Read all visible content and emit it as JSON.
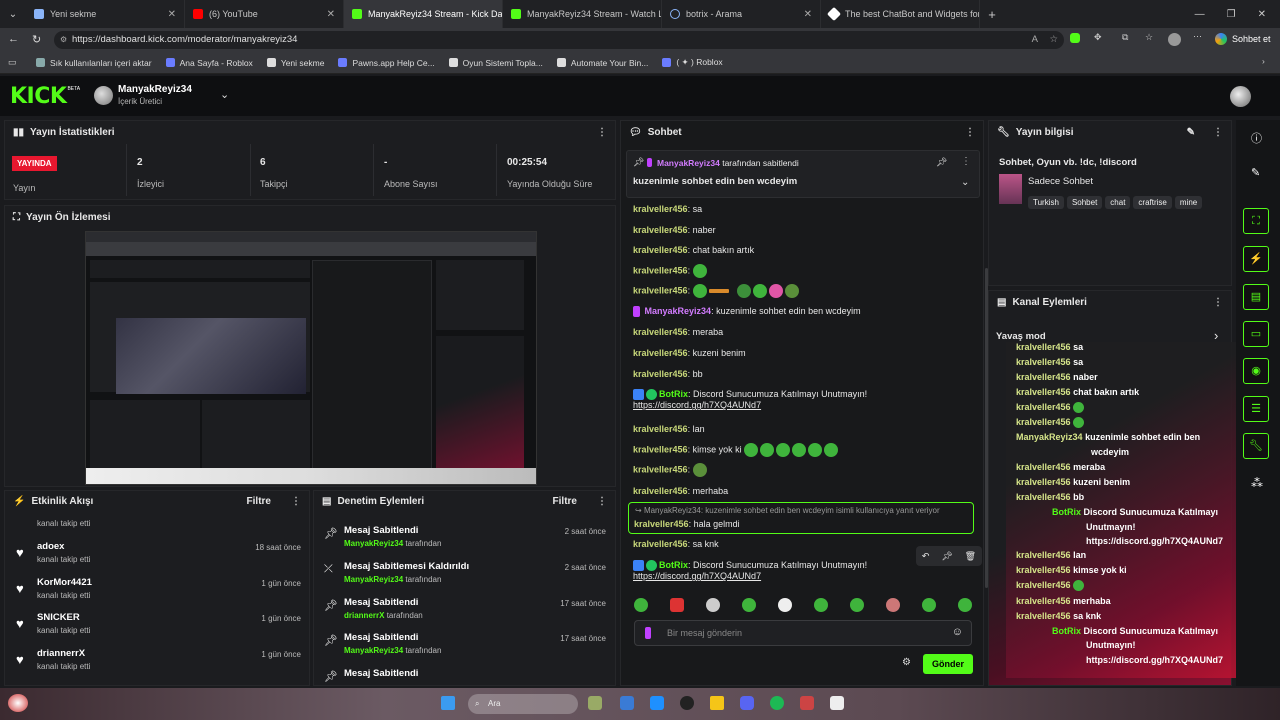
{
  "tabs": [
    {
      "title": "Yeni sekme",
      "icon": "new-tab-icon",
      "color": "#8ab4f8"
    },
    {
      "title": "(6) YouTube",
      "icon": "youtube-icon",
      "color": "#ff0000"
    },
    {
      "title": "ManyakReyiz34 Stream - Kick Dash",
      "icon": "kick-icon",
      "color": "#53fc18",
      "active": true
    },
    {
      "title": "ManyakReyiz34 Stream - Watch Li",
      "icon": "kick-icon",
      "color": "#53fc18"
    },
    {
      "title": "botrix - Arama",
      "icon": "search-icon",
      "color": "#8ab4f8"
    },
    {
      "title": "The best ChatBot and Widgets for",
      "icon": "botrix-icon",
      "color": "#ffffff"
    }
  ],
  "address": {
    "url": "https://dashboard.kick.com/moderator/manyakreyiz34",
    "chat_button": "Sohbet et"
  },
  "bookmarks": [
    "Sık kullanılanları içeri aktar",
    "Ana Sayfa - Roblox",
    "Yeni sekme",
    "Pawns.app Help Ce...",
    "Oyun Sistemi Topla...",
    "Automate Your Bin...",
    "( ✦ ) Roblox"
  ],
  "header": {
    "logo": "KICK",
    "beta": "BETA",
    "channel": "ManyakReyiz34",
    "role": "İçerik Üretici"
  },
  "stats": {
    "title": "Yayın İstatistikleri",
    "live_badge": "YAYINDA",
    "live_label": "Yayın",
    "viewers": "2",
    "viewers_label": "İzleyici",
    "followers": "6",
    "followers_label": "Takipçi",
    "subs": "-",
    "subs_label": "Abone Sayısı",
    "uptime": "00:25:54",
    "uptime_label": "Yayında Olduğu Süre"
  },
  "preview": {
    "title": "Yayın Ön İzlemesi"
  },
  "activity": {
    "title": "Etkinlik Akışı",
    "filter": "Filtre",
    "top_text": "kanalı takip etti",
    "items": [
      {
        "name": "adoex",
        "sub": "kanalı takip etti",
        "time": "18 saat önce"
      },
      {
        "name": "KorMor4421",
        "sub": "kanalı takip etti",
        "time": "1 gün önce"
      },
      {
        "name": "SNICKER",
        "sub": "kanalı takip etti",
        "time": "1 gün önce"
      },
      {
        "name": "driannerrX",
        "sub": "kanalı takip etti",
        "time": "1 gün önce"
      }
    ]
  },
  "modactions": {
    "title": "Denetim Eylemleri",
    "filter": "Filtre",
    "items": [
      {
        "action": "Mesaj Sabitlendi",
        "by": "ManyakReyiz34",
        "suffix": "tarafından",
        "time": "2 saat önce"
      },
      {
        "action": "Mesaj Sabitlemesi Kaldırıldı",
        "by": "ManyakReyiz34",
        "suffix": "tarafından",
        "time": "2 saat önce"
      },
      {
        "action": "Mesaj Sabitlendi",
        "by": "driannerrX",
        "suffix": "tarafından",
        "time": "17 saat önce"
      },
      {
        "action": "Mesaj Sabitlendi",
        "by": "ManyakReyiz34",
        "suffix": "tarafından",
        "time": "17 saat önce"
      },
      {
        "action": "Mesaj Sabitlendi",
        "by": "",
        "suffix": "",
        "time": ""
      }
    ]
  },
  "chat": {
    "title": "Sohbet",
    "pinned_by": "ManyakReyiz34",
    "pinned_suffix": "tarafından sabitlendi",
    "pinned_msg": "kuzenimle sohbet edin ben wcdeyim",
    "messages": [
      {
        "user": "kralveller456",
        "text": "sa"
      },
      {
        "user": "kralveller456",
        "text": "naber"
      },
      {
        "user": "kralveller456",
        "text": "chat bakın artık"
      },
      {
        "user": "kralveller456",
        "text": ""
      },
      {
        "user": "kralveller456",
        "text": ""
      },
      {
        "user": "ManyakReyiz34",
        "text": "kuzenimle sohbet edin ben wcdeyim"
      },
      {
        "user": "kralveller456",
        "text": "meraba"
      },
      {
        "user": "kralveller456",
        "text": "kuzeni benim"
      },
      {
        "user": "kralveller456",
        "text": "bb"
      },
      {
        "user": "BotRix",
        "text": "Discord Sunucumuza Katılmayı Unutmayın!",
        "link": "https://discord.gg/h7XQ4AUNd7"
      },
      {
        "user": "kralveller456",
        "text": "lan"
      },
      {
        "user": "kralveller456",
        "text": "kimse yok ki"
      },
      {
        "user": "kralveller456",
        "text": ""
      },
      {
        "user": "kralveller456",
        "text": "merhaba"
      },
      {
        "user": "kralveller456",
        "text": "hala gelmdi",
        "reply": "ManyakReyiz34: kuzenimle sohbet edin ben wcdeyim isimli kullanıcıya yanıt veriyor"
      },
      {
        "user": "kralveller456",
        "text": "sa knk"
      },
      {
        "user": "BotRix",
        "text": "Discord Sunucumuza Katılmayı Unutmayın!",
        "link": "https://discord.gg/h7XQ4AUNd7"
      }
    ],
    "input_placeholder": "Bir mesaj gönderin",
    "send": "Gönder"
  },
  "info": {
    "title": "Yayın bilgisi",
    "stream_title": "Sohbet, Oyun vb. !dc, !discord",
    "category": "Sadece Sohbet",
    "tags": [
      "Turkish",
      "Sohbet",
      "chat",
      "craftrise",
      "mine"
    ]
  },
  "channel_actions": {
    "title": "Kanal Eylemleri",
    "slow_mode": "Yavaş mod"
  },
  "overlay": [
    {
      "user": "kralveller456",
      "text": "sa"
    },
    {
      "user": "kralveller456",
      "text": "sa"
    },
    {
      "user": "kralveller456",
      "text": "naber"
    },
    {
      "user": "kralveller456",
      "text": "chat bakın artık"
    },
    {
      "user": "kralveller456",
      "text": ""
    },
    {
      "user": "kralveller456",
      "text": ""
    },
    {
      "user": "ManyakReyiz34",
      "text": "kuzenimle sohbet edin ben"
    },
    {
      "user": "",
      "text": "wcdeyim"
    },
    {
      "user": "kralveller456",
      "text": "meraba"
    },
    {
      "user": "kralveller456",
      "text": "kuzeni benim"
    },
    {
      "user": "kralveller456",
      "text": "bb"
    },
    {
      "user": "BotRix",
      "text": "Discord Sunucumuza Katılmayı"
    },
    {
      "user": "",
      "text": "Unutmayın!"
    },
    {
      "user": "",
      "text": "https://discord.gg/h7XQ4AUNd7"
    },
    {
      "user": "kralveller456",
      "text": "lan"
    },
    {
      "user": "kralveller456",
      "text": "kimse yok ki"
    },
    {
      "user": "kralveller456",
      "text": ""
    },
    {
      "user": "kralveller456",
      "text": "merhaba"
    },
    {
      "user": "kralveller456",
      "text": "sa knk"
    },
    {
      "user": "BotRix",
      "text": "Discord Sunucumuza Katılmayı"
    },
    {
      "user": "",
      "text": "Unutmayın!"
    },
    {
      "user": "",
      "text": "https://discord.gg/h7XQ4AUNd7"
    }
  ],
  "taskbar": {
    "search": "Ara"
  },
  "colors": {
    "accent": "#53fc18",
    "live": "#e8172f",
    "bg": "#1a1b1e"
  }
}
